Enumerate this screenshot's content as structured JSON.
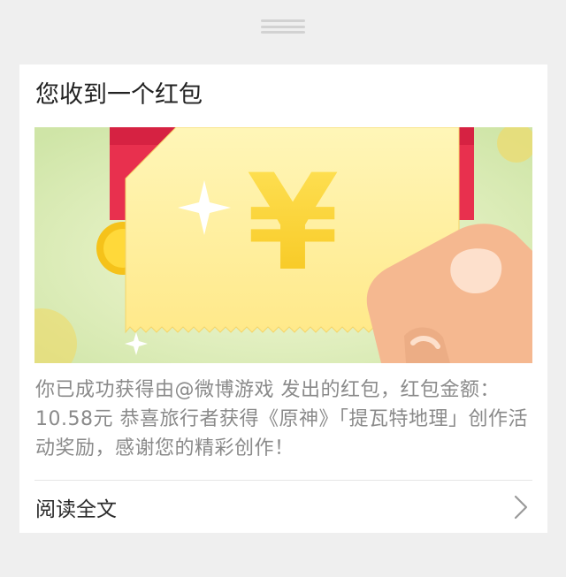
{
  "card": {
    "title": "您收到一个红包",
    "body": "你已成功获得由@微博游戏 发出的红包，红包金额：10.58元 恭喜旅行者获得《原神》「提瓦特地理」创作活动奖励，感谢您的精彩创作！",
    "read_more_label": "阅读全文"
  },
  "banner": {
    "currency_symbol": "¥"
  },
  "icons": {
    "drag": "drag-handle-icon",
    "chevron": "chevron-right-icon"
  },
  "colors": {
    "background": "#efefef",
    "card": "#ffffff",
    "envelope_red": "#e8304e",
    "envelope_card": "#fff1a0",
    "coin": "#f5c21a",
    "banner_green": "#d9ebb4"
  }
}
